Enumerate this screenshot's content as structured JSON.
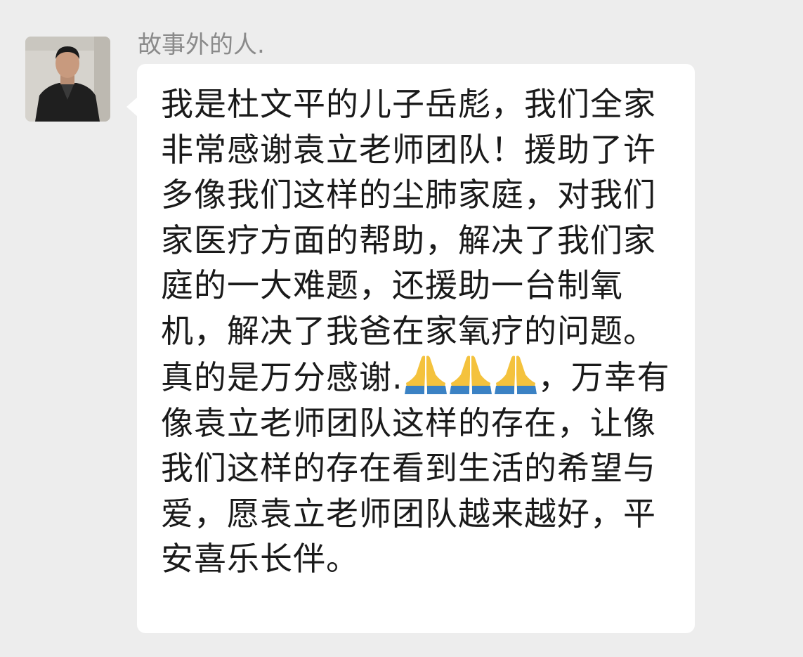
{
  "sender": {
    "name": "故事外的人."
  },
  "message": {
    "segments": [
      "我是杜文平的儿子岳彪，我们全家非常感谢袁立老师团队！援助了许多像我们这样的尘肺家庭，对我们家医疗方面的帮助，解决了我们家庭的一大难题，还援助一台制氧机，解决了我爸在家氧疗的问题。真的是万分感谢.",
      "，万幸有像袁立老师团队这样的存在，让像我们这样的存在看到生活的希望与爱，愿袁立老师团队越来越好，平安喜乐长伴。"
    ],
    "emoji": "🙏"
  },
  "colors": {
    "background": "#ededed",
    "bubble": "#ffffff",
    "name_text": "#8a8a8a",
    "message_text": "#1a1a1a"
  },
  "icons": {
    "pray": "folded-hands-icon"
  }
}
